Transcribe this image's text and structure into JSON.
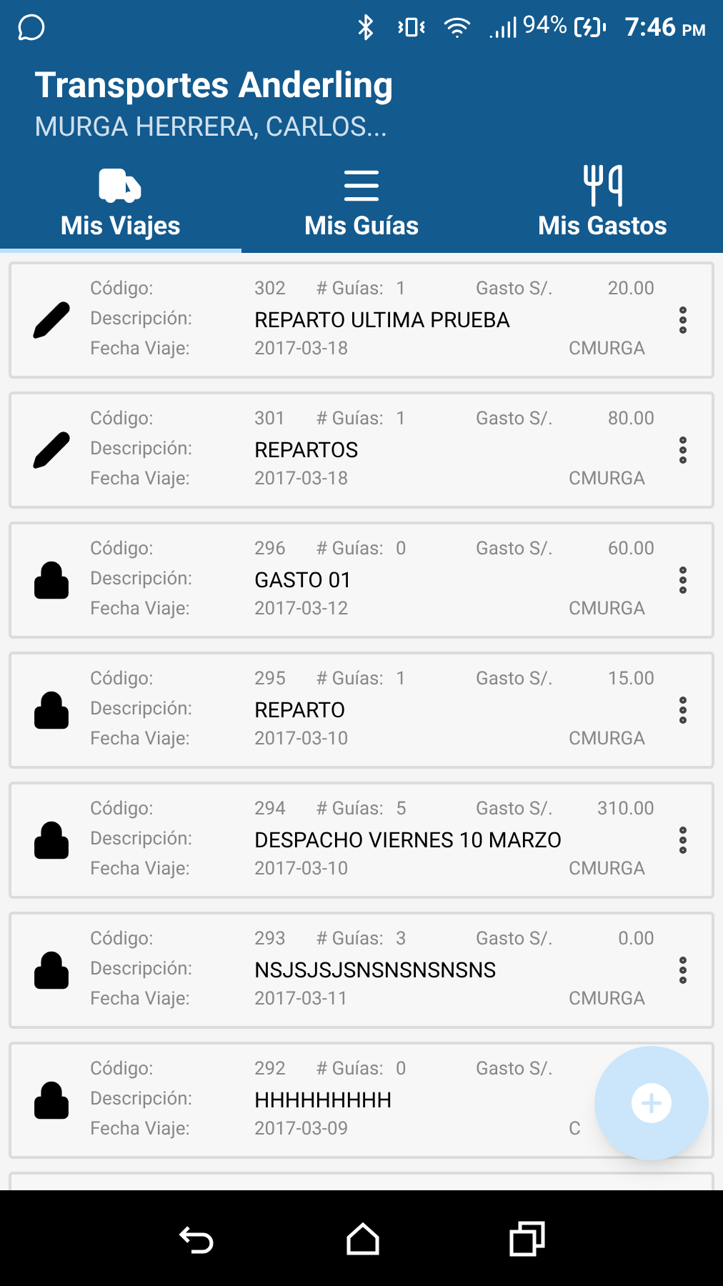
{
  "status_bar": {
    "battery": "94%",
    "time": "7:46",
    "ampm": "PM"
  },
  "header": {
    "title": "Transportes Anderling",
    "subtitle": "MURGA HERRERA, CARLOS..."
  },
  "tabs": [
    {
      "label": "Mis Viajes",
      "kind": "truck",
      "selected": true
    },
    {
      "label": "Mis Guías",
      "kind": "list",
      "selected": false
    },
    {
      "label": "Mis Gastos",
      "kind": "cutlery",
      "selected": false
    }
  ],
  "trips": [
    {
      "kind": "edit",
      "code_label": "Código:",
      "code": "302",
      "guides_label": "# Guías:",
      "guides": "1",
      "expense_label": "Gasto S/.",
      "amount": "20.00",
      "description_label": "Descripción:",
      "description": "REPARTO ULTIMA PRUEBA",
      "date_label": "Fecha Viaje:",
      "date": "2017-03-18",
      "user": "CMURGA"
    },
    {
      "kind": "edit",
      "code_label": "Código:",
      "code": "301",
      "guides_label": "# Guías:",
      "guides": "1",
      "expense_label": "Gasto S/.",
      "amount": "80.00",
      "description_label": "Descripción:",
      "description": "REPARTOS",
      "date_label": "Fecha Viaje:",
      "date": "2017-03-18",
      "user": "CMURGA"
    },
    {
      "kind": "locked",
      "code_label": "Código:",
      "code": "296",
      "guides_label": "# Guías:",
      "guides": "0",
      "expense_label": "Gasto S/.",
      "amount": "60.00",
      "description_label": "Descripción:",
      "description": "GASTO 01",
      "date_label": "Fecha Viaje:",
      "date": "2017-03-12",
      "user": "CMURGA"
    },
    {
      "kind": "locked",
      "code_label": "Código:",
      "code": "295",
      "guides_label": "# Guías:",
      "guides": "1",
      "expense_label": "Gasto S/.",
      "amount": "15.00",
      "description_label": "Descripción:",
      "description": "REPARTO",
      "date_label": "Fecha Viaje:",
      "date": "2017-03-10",
      "user": "CMURGA"
    },
    {
      "kind": "locked",
      "code_label": "Código:",
      "code": "294",
      "guides_label": "# Guías:",
      "guides": "5",
      "expense_label": "Gasto S/.",
      "amount": "310.00",
      "description_label": "Descripción:",
      "description": "DESPACHO VIERNES 10 MARZO",
      "date_label": "Fecha Viaje:",
      "date": "2017-03-10",
      "user": "CMURGA"
    },
    {
      "kind": "locked",
      "code_label": "Código:",
      "code": "293",
      "guides_label": "# Guías:",
      "guides": "3",
      "expense_label": "Gasto S/.",
      "amount": "0.00",
      "description_label": "Descripción:",
      "description": "NSJSJSJSNSNSNSNSNS",
      "date_label": "Fecha Viaje:",
      "date": "2017-03-11",
      "user": "CMURGA"
    },
    {
      "kind": "locked",
      "code_label": "Código:",
      "code": "292",
      "guides_label": "# Guías:",
      "guides": "0",
      "expense_label": "Gasto S/.",
      "description_label": "Descripción:",
      "description": "HHHHHHHHH",
      "date_label": "Fecha Viaje:",
      "date": "2017-03-09",
      "user": "C"
    }
  ]
}
